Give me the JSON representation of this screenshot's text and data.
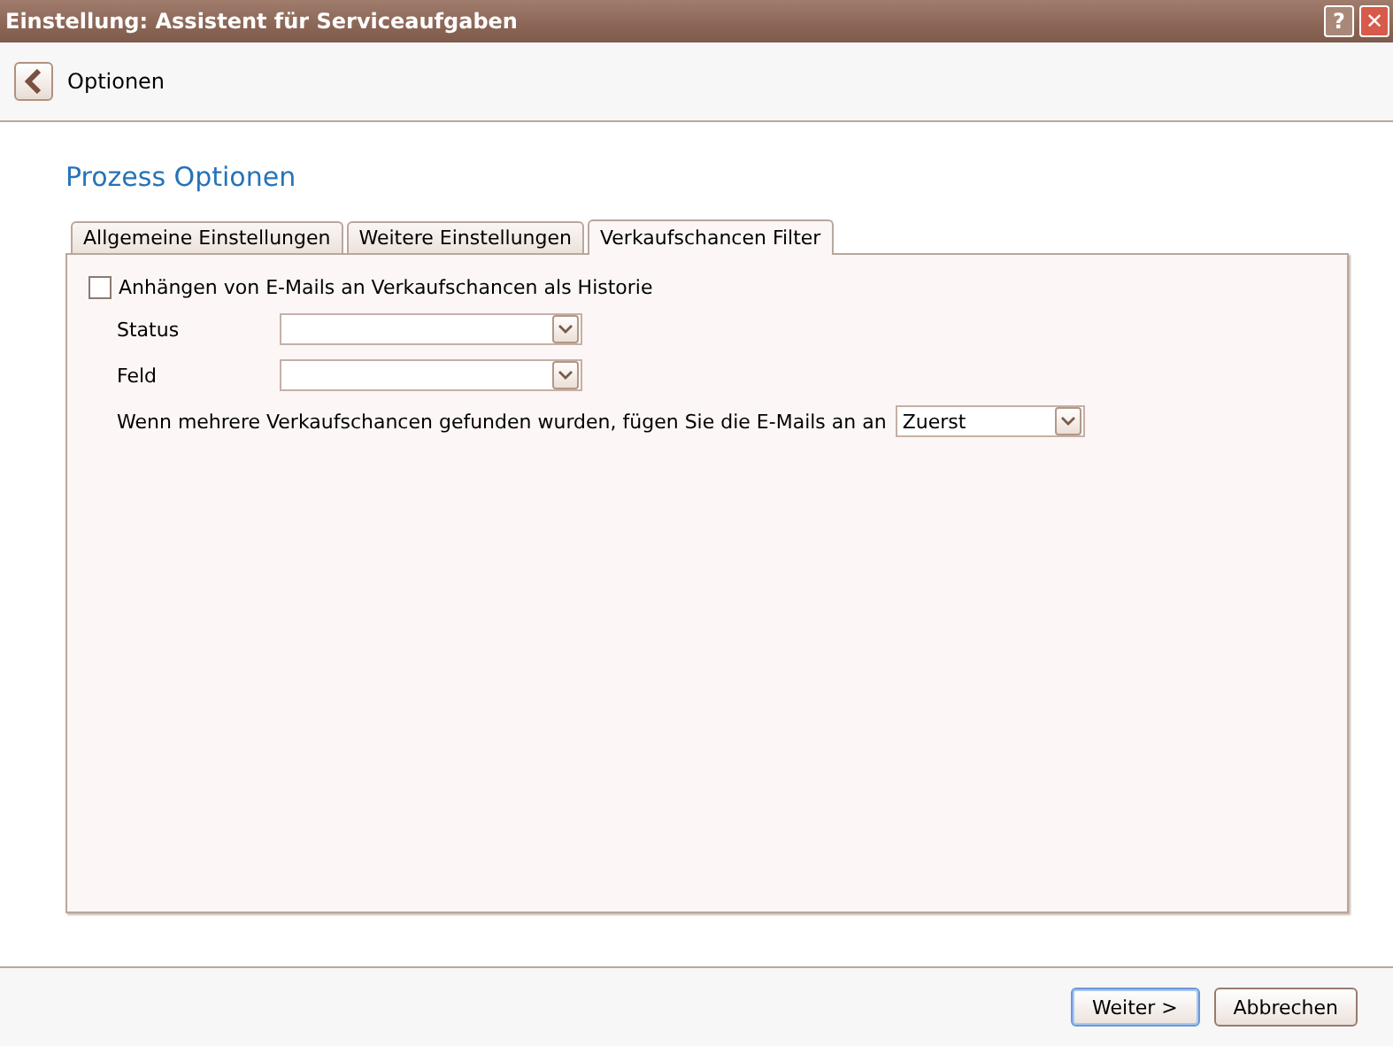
{
  "window": {
    "title": "Einstellung: Assistent für Serviceaufgaben",
    "help": "?",
    "close": "✕"
  },
  "header": {
    "title": "Optionen"
  },
  "heading": "Prozess Optionen",
  "tabs": [
    {
      "label": "Allgemeine Einstellungen",
      "selected": false
    },
    {
      "label": "Weitere Einstellungen",
      "selected": false
    },
    {
      "label": "Verkaufschancen Filter",
      "selected": true
    }
  ],
  "checkbox": {
    "label": "Anhängen von E-Mails an Verkaufschancen als Historie",
    "checked": false
  },
  "fields": [
    {
      "label": "Status"
    },
    {
      "label": "Feld"
    }
  ],
  "attach": {
    "label": "Wenn mehrere Verkaufschancen gefunden wurden, fügen Sie die E-Mails an an",
    "value": "Zuerst"
  },
  "buttons": [
    {
      "label": "Weiter >",
      "focused": true
    },
    {
      "label": "Abbrechen",
      "focused": false
    }
  ]
}
